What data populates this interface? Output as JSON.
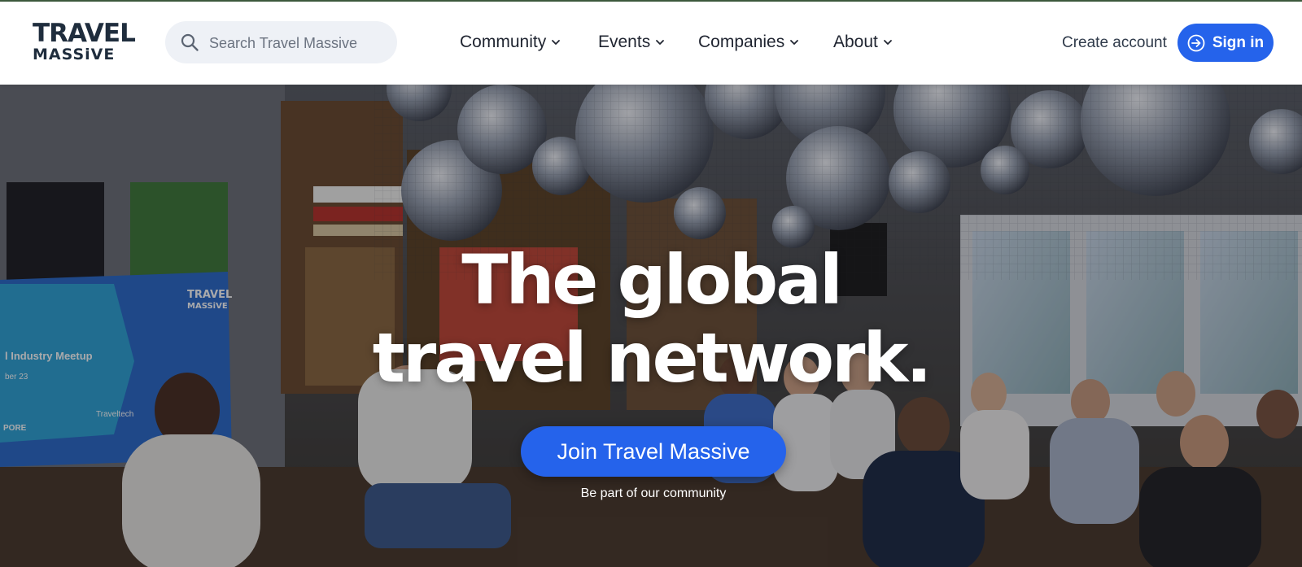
{
  "brand": {
    "line1": "TRAVEL",
    "line2": "MASSiVE"
  },
  "search": {
    "placeholder": "Search Travel Massive"
  },
  "nav": {
    "items": [
      {
        "label": "Community"
      },
      {
        "label": "Events"
      },
      {
        "label": "Companies"
      },
      {
        "label": "About"
      }
    ]
  },
  "account": {
    "create_label": "Create account",
    "signin_label": "Sign in"
  },
  "hero": {
    "headline_line1": "The global",
    "headline_line2": "travel network.",
    "cta_label": "Join Travel Massive",
    "subtext": "Be part of our community",
    "screen": {
      "logo_line1": "TRAVEL",
      "logo_line2": "MASSiVE",
      "text1": "l Industry Meetup",
      "text2": "ber 23",
      "text3": "Traveltech",
      "text4": "PORE"
    }
  },
  "colors": {
    "accent": "#2563eb",
    "text": "#1f2430",
    "search_bg": "#eef1f6"
  },
  "icons": {
    "search": "search-icon",
    "signin": "arrow-circle-right-icon",
    "dropdown": "chevron-down-icon"
  }
}
